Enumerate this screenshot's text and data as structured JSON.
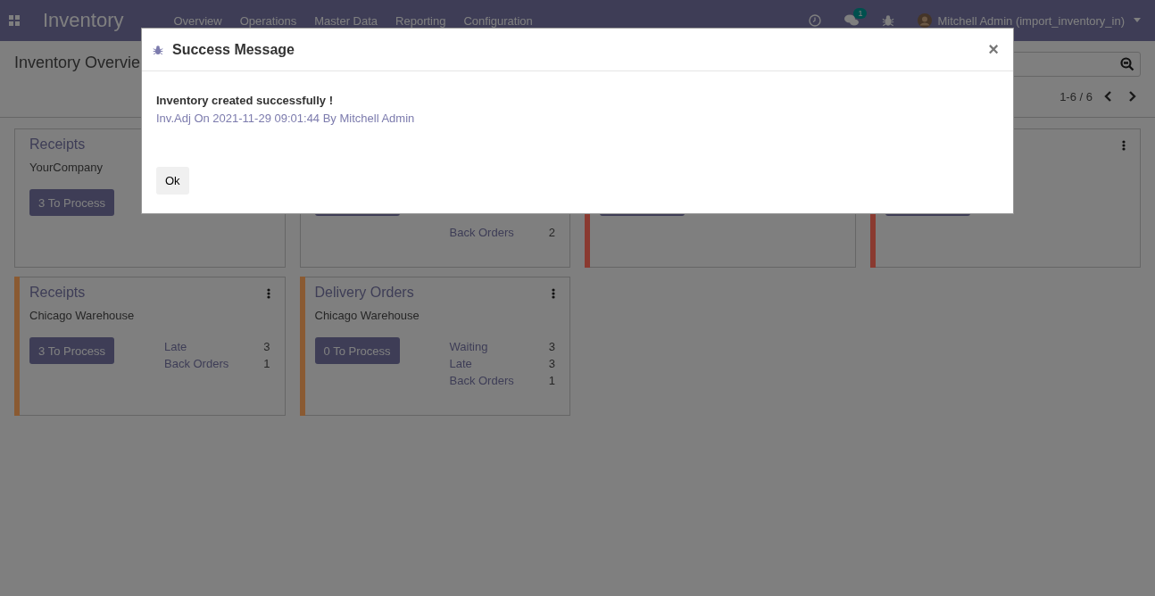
{
  "navbar": {
    "app_name": "Inventory",
    "menu": [
      "Overview",
      "Operations",
      "Master Data",
      "Reporting",
      "Configuration"
    ],
    "chat_badge": "1",
    "user": "Mitchell Admin (import_inventory_in)"
  },
  "control_panel": {
    "breadcrumb": "Inventory Overvie",
    "pager": "1-6 / 6"
  },
  "cards": [
    {
      "title": "Receipts",
      "subtitle": "YourCompany",
      "button": "3 To Process"
    },
    {
      "stats": [
        {
          "kind": "covered"
        },
        {
          "kind": "covered"
        },
        {
          "kind": "stat",
          "label": "Back Orders",
          "value": "2"
        }
      ]
    },
    {
      "color": "#8a3a30"
    },
    {
      "color": "#8a3a30",
      "menu": true
    },
    {
      "title": "Receipts",
      "subtitle": "Chicago Warehouse",
      "color": "#8a5a32",
      "menu": true,
      "button": "3 To Process",
      "stats": [
        {
          "kind": "stat",
          "label": "Late",
          "value": "3"
        },
        {
          "kind": "stat",
          "label": "Back Orders",
          "value": "1"
        }
      ]
    },
    {
      "title": "Delivery Orders",
      "subtitle": "Chicago Warehouse",
      "color": "#8a5a32",
      "menu": true,
      "button": "0 To Process",
      "stats": [
        {
          "kind": "stat",
          "label": "Waiting",
          "value": "3"
        },
        {
          "kind": "stat",
          "label": "Late",
          "value": "3"
        },
        {
          "kind": "stat",
          "label": "Back Orders",
          "value": "1"
        }
      ]
    }
  ],
  "dialog": {
    "title": "Success Message",
    "message": "Inventory created successfully !",
    "detail": "Inv.Adj On 2021-11-29 09:01:44 By Mitchell Admin",
    "button": "Ok",
    "close": "×"
  }
}
